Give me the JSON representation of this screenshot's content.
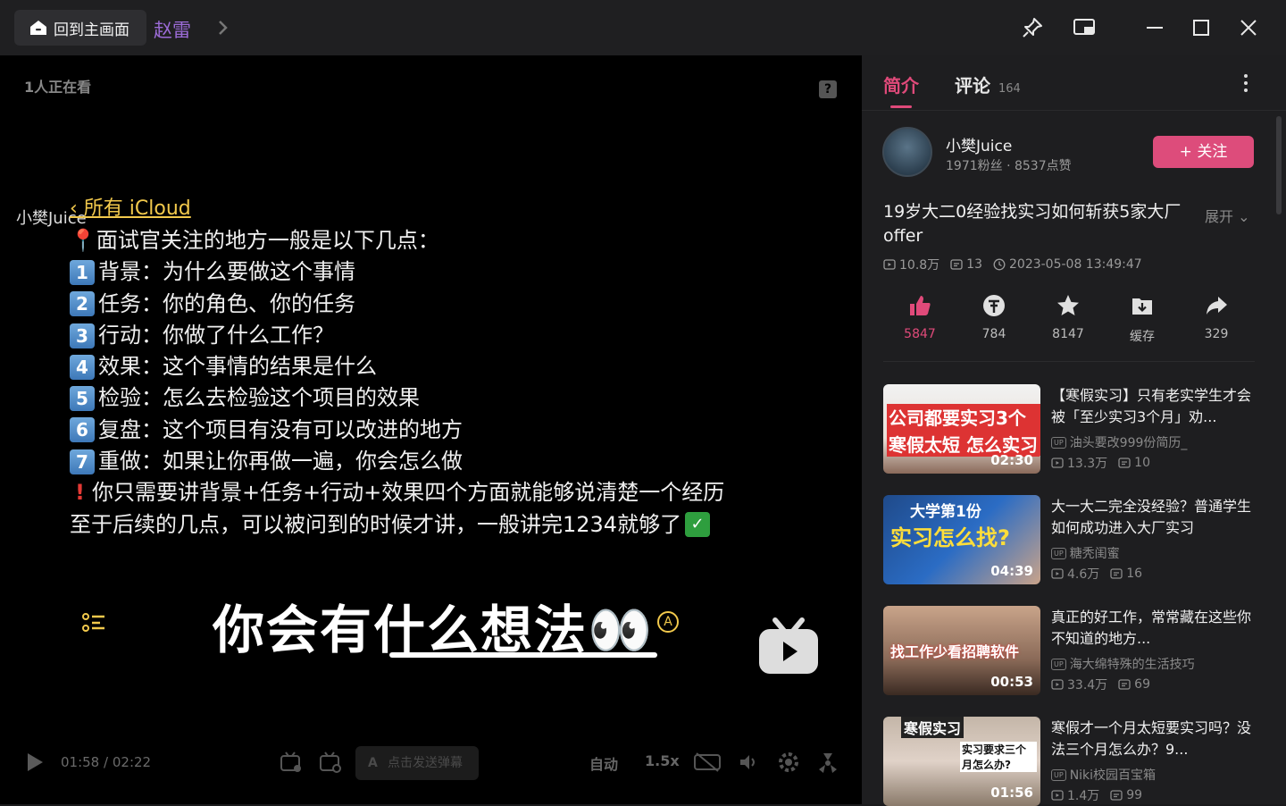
{
  "titlebar": {
    "home_label": "回到主画面",
    "overlay_title": "赵雷",
    "colors": {
      "bg": "#1f1f21",
      "home_bg": "#2e2e31"
    }
  },
  "player": {
    "watching": "1人正在看",
    "watermark": "小樊Juice",
    "back_link": "所有 iCloud",
    "note_intro": "📍面试官关注的地方一般是以下几点：",
    "points": [
      {
        "num": "1",
        "text": "背景：为什么要做这个事情"
      },
      {
        "num": "2",
        "text": "任务：你的角色、你的任务"
      },
      {
        "num": "3",
        "text": "行动：你做了什么工作？"
      },
      {
        "num": "4",
        "text": "效果：这个事情的结果是什么"
      },
      {
        "num": "5",
        "text": "检验：怎么去检验这个项目的效果"
      },
      {
        "num": "6",
        "text": "复盘：这个项目有没有可以改进的地方"
      },
      {
        "num": "7",
        "text": "重做：如果让你再做一遍，你会怎么做"
      }
    ],
    "warning_line": "你只需要讲背景+任务+行动+效果四个方面就能够说清楚一个经历",
    "closing_line": "至于后续的几点，可以被问到的时候才讲，一般讲完1234就够了",
    "big_caption": "你会有什么想法👀",
    "current_time": "01:58",
    "time_sep": "/",
    "total_time": "02:22",
    "danmaku_placeholder": "点击发送弹幕",
    "quality": "自动",
    "speed": "1.5x"
  },
  "sidebar": {
    "tab_intro": "简介",
    "tab_comments": "评论",
    "comment_count": "164",
    "uploader": {
      "name": "小樊Juice",
      "stats": "1971粉丝 · 8537点赞"
    },
    "follow_label": "+ 关注",
    "video_title": "19岁大二0经验找实习如何斩获5家大厂offer",
    "expand_label": "展开",
    "views": "10.8万",
    "danmaku": "13",
    "date": "2023-05-08 13:49:47",
    "actions": [
      {
        "icon": "thumbs-up-icon",
        "label": "5847"
      },
      {
        "icon": "coin-icon",
        "label": "784"
      },
      {
        "icon": "star-icon",
        "label": "8147"
      },
      {
        "icon": "download-icon",
        "label": "缓存"
      },
      {
        "icon": "share-icon",
        "label": "329"
      }
    ],
    "recommendations": [
      {
        "thumb_text_1": "公司都要实习3个月",
        "thumb_text_2": "寒假太短 怎么实习",
        "duration": "02:30",
        "title": "【寒假实习】只有老实学生才会被「至少实习3个月」劝...",
        "uploader": "油头要改999份简历_",
        "views": "13.3万",
        "danmaku": "10"
      },
      {
        "thumb_text_1": "大学第1份",
        "thumb_text_2": "实习怎么找?",
        "duration": "04:39",
        "title": "大一大二完全没经验？普通学生如何成功进入大厂实习",
        "uploader": "糖秃闺蜜",
        "views": "4.6万",
        "danmaku": "16"
      },
      {
        "thumb_text_1": "找工作少看招聘软件",
        "thumb_text_2": "",
        "duration": "00:53",
        "title": "真正的好工作，常常藏在这些你不知道的地方...",
        "uploader": "海大绵特殊的生活技巧",
        "views": "33.4万",
        "danmaku": "69"
      },
      {
        "thumb_text_1": "寒假实习",
        "thumb_text_2": "实习要求三个月怎么办?",
        "duration": "01:56",
        "title": "寒假才一个月太短要实习吗？没法三个月怎么办？9...",
        "uploader": "Niki校园百宝箱",
        "views": "1.4万",
        "danmaku": "99"
      }
    ],
    "accent": "#dd4c7b"
  }
}
